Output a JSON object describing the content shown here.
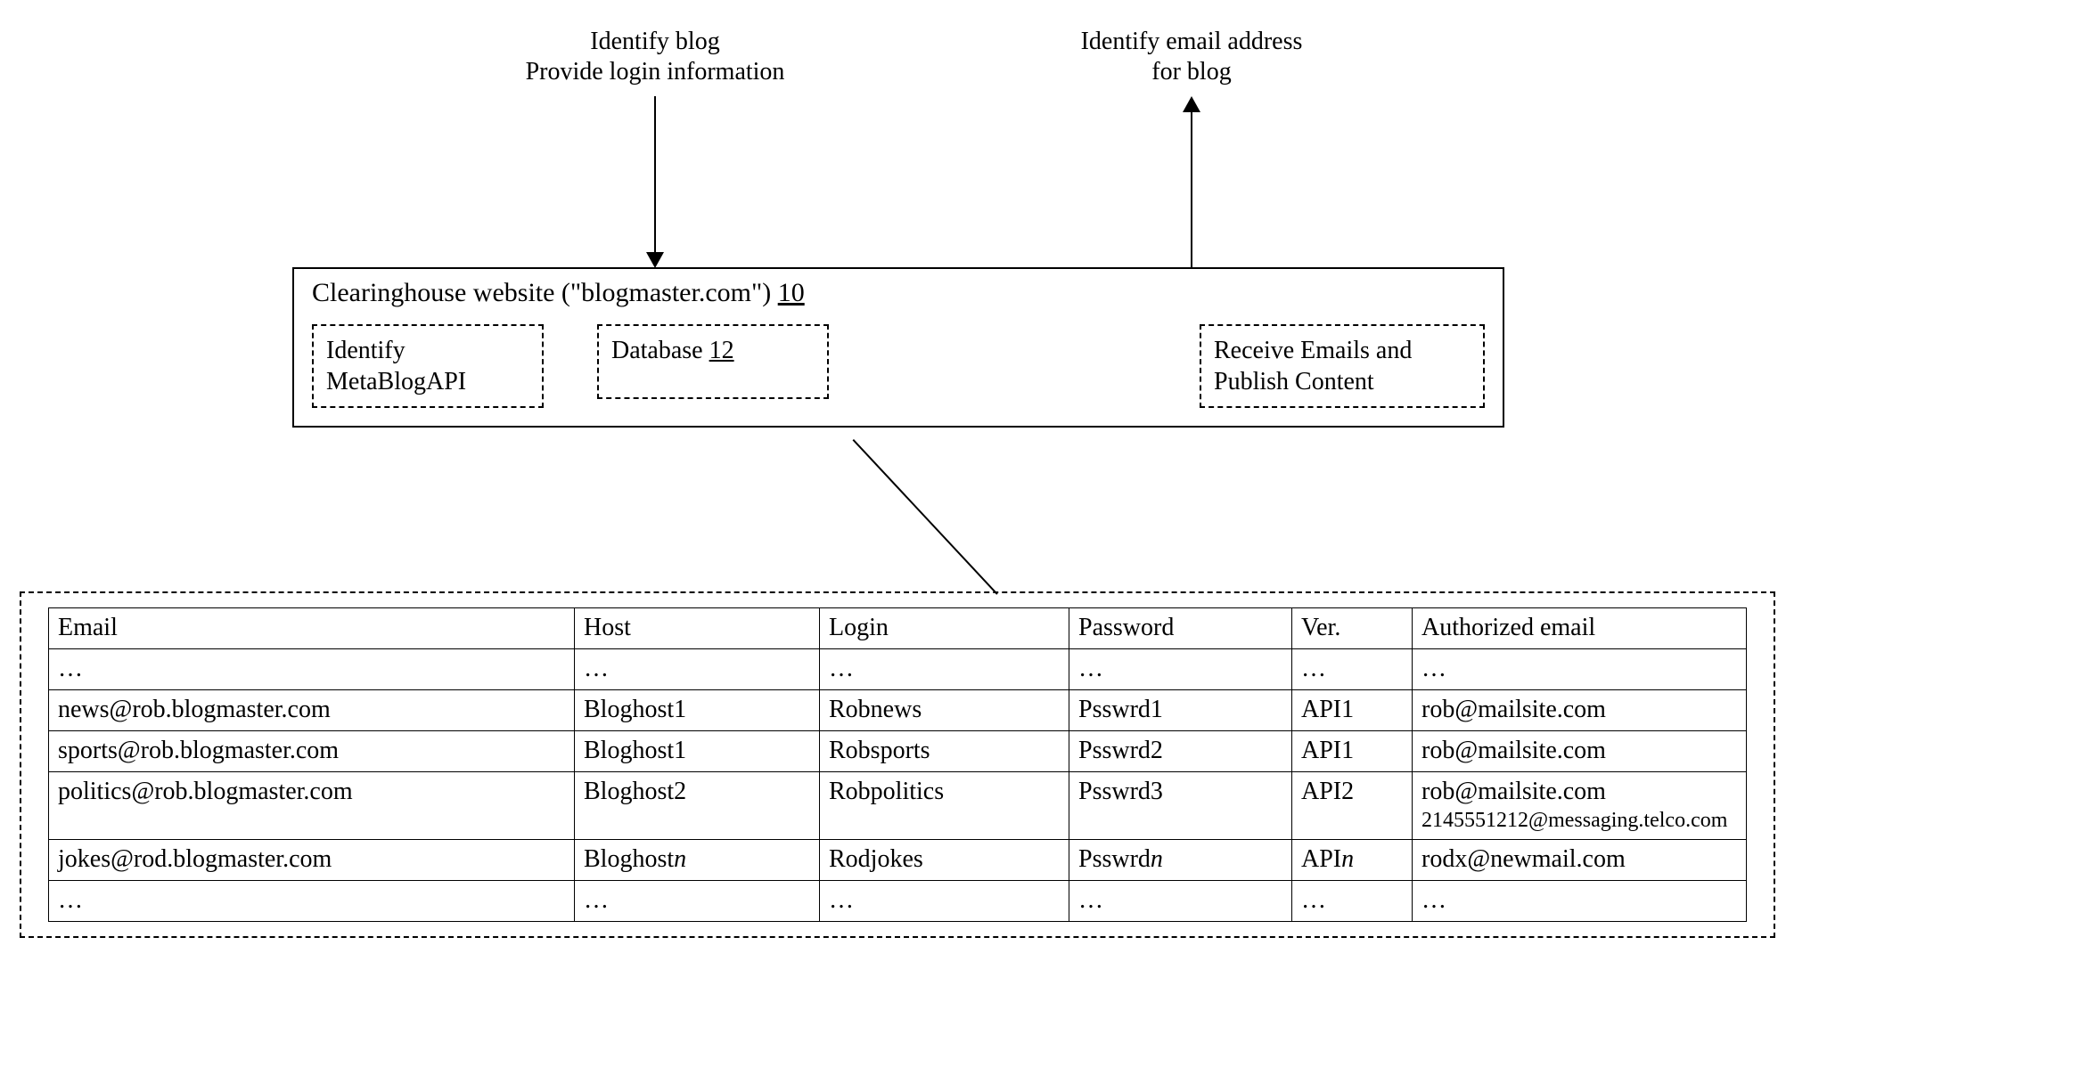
{
  "top_labels": {
    "left_line1": "Identify blog",
    "left_line2": "Provide login information",
    "right_line1": "Identify email address",
    "right_line2": "for blog"
  },
  "clearinghouse": {
    "title_prefix": "Clearinghouse website (\"blogmaster.com\") ",
    "title_ref": "10",
    "box1_line1": "Identify",
    "box1_line2": "MetaBlogAPI",
    "box2_prefix": "Database ",
    "box2_ref": "12",
    "box3_line1": "Receive Emails and",
    "box3_line2": "Publish Content"
  },
  "table": {
    "headers": [
      "Email",
      "Host",
      "Login",
      "Password",
      "Ver.",
      "Authorized email"
    ],
    "ellipsis": "…",
    "rows": [
      {
        "email": "news@rob.blogmaster.com",
        "host": "Bloghost1",
        "login": "Robnews",
        "password": "Psswrd1",
        "ver": "API1",
        "auth": [
          "rob@mailsite.com"
        ]
      },
      {
        "email": "sports@rob.blogmaster.com",
        "host": "Bloghost1",
        "login": "Robsports",
        "password": "Psswrd2",
        "ver": "API1",
        "auth": [
          "rob@mailsite.com"
        ]
      },
      {
        "email": "politics@rob.blogmaster.com",
        "host": "Bloghost2",
        "login": "Robpolitics",
        "password": "Psswrd3",
        "ver": "API2",
        "auth": [
          "rob@mailsite.com",
          "2145551212@messaging.telco.com"
        ]
      },
      {
        "email": "jokes@rod.blogmaster.com",
        "host_prefix": "Bloghost",
        "host_suffix": "n",
        "login": "Rodjokes",
        "pw_prefix": "Psswrd",
        "pw_suffix": "n",
        "ver_prefix": "API",
        "ver_suffix": "n",
        "auth": [
          "rodx@newmail.com"
        ]
      }
    ]
  }
}
